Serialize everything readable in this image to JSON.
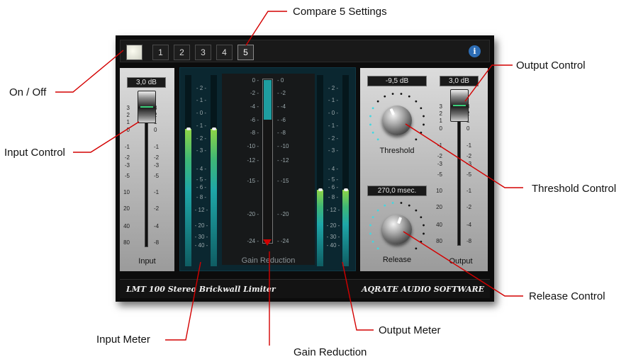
{
  "annotations": {
    "compare": "Compare 5 Settings",
    "on_off": "On / Off",
    "input_control": "Input Control",
    "output_control": "Output Control",
    "threshold_control": "Threshold Control",
    "release_control": "Release Control",
    "input_meter": "Input Meter",
    "gain_reduction": "Gain Reduction",
    "output_meter": "Output Meter"
  },
  "topbar": {
    "compare_buttons": [
      "1",
      "2",
      "3",
      "4",
      "5"
    ],
    "active_compare": "5",
    "info": "i"
  },
  "input": {
    "readout": "3,0 dB",
    "label": "Input",
    "level_db": 3.0,
    "left_scale": [
      "3",
      "2",
      "1",
      "0",
      "-1",
      "-2",
      "-3",
      "-5",
      "10",
      "20",
      "40",
      "80"
    ],
    "right_scale": [
      "3",
      "2",
      "1",
      "0",
      "-1",
      "-2",
      "-3",
      "-5",
      "-1",
      "-2",
      "-4",
      "-8"
    ]
  },
  "meters": {
    "input_scale": [
      "2",
      "1",
      "0",
      "1",
      "2",
      "3",
      "4",
      "5",
      "6",
      "8",
      "12",
      "20",
      "30",
      "40"
    ],
    "input_levels": [
      0.72,
      0.72
    ],
    "output_scale": [
      "2",
      "1",
      "0",
      "1",
      "2",
      "3",
      "4",
      "5",
      "6",
      "8",
      "12",
      "20",
      "30",
      "40"
    ],
    "output_levels": [
      0.4,
      0.4
    ]
  },
  "gain_reduction": {
    "scale": [
      "0",
      "-2",
      "-4",
      "-6",
      "-8",
      "-10",
      "-12",
      "-15",
      "-20",
      "-24"
    ],
    "label": "Gain Reduction",
    "value_db": -6
  },
  "threshold": {
    "readout": "-9,5 dB",
    "label": "Threshold"
  },
  "release": {
    "readout": "270,0 msec.",
    "label": "Release"
  },
  "output": {
    "readout": "3,0 dB",
    "label": "Output",
    "level_db": 3.0,
    "left_scale": [
      "3",
      "2",
      "1",
      "0",
      "-1",
      "-2",
      "-3",
      "-5",
      "10",
      "20",
      "40",
      "80"
    ],
    "right_scale": [
      "3",
      "2",
      "1",
      "0",
      "-1",
      "-2",
      "-3",
      "-5",
      "-1",
      "-2",
      "-4",
      "-8"
    ]
  },
  "footer": {
    "product": "LMT 100 Stereo Brickwall Limiter",
    "vendor": "AQRATE AUDIO SOFTWARE"
  },
  "colors": {
    "annotation_line": "#d40000",
    "meter_fill": "#1ea6a8",
    "meter_fill_top": "#8fd645",
    "gr_fill": "#1e9da0"
  }
}
